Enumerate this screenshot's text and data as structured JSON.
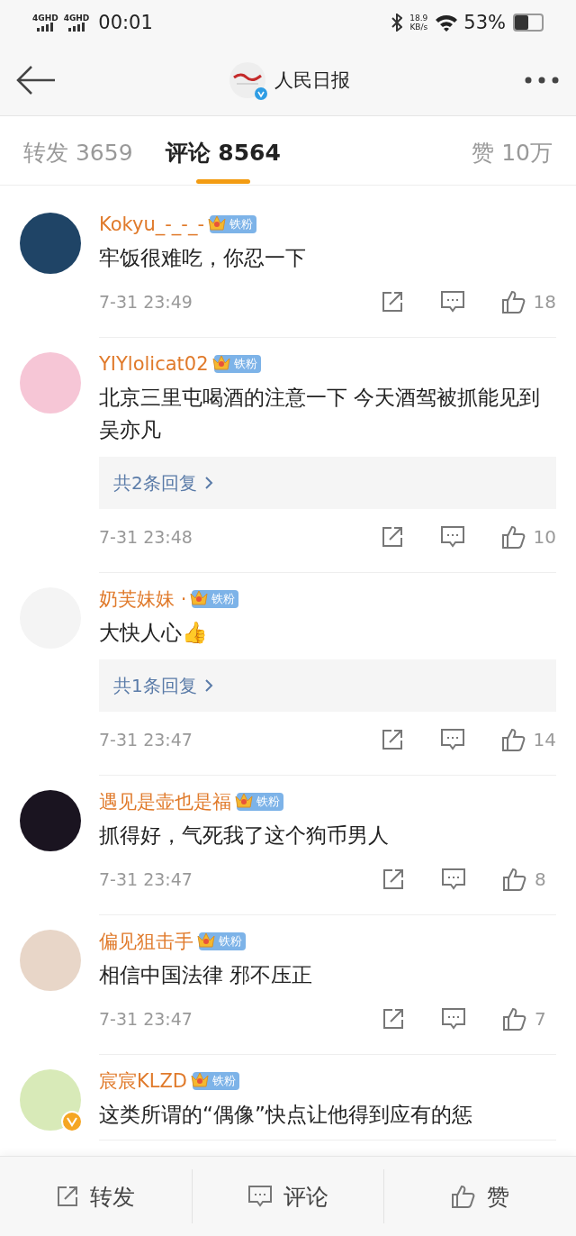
{
  "status_bar": {
    "networks": [
      "4GHD",
      "4GHD"
    ],
    "time": "00:01",
    "speed": "18.9",
    "speed_unit": "KB/s",
    "battery": "53%"
  },
  "header": {
    "title": "人民日报"
  },
  "tabs": [
    {
      "label": "转发 3659",
      "selected": false
    },
    {
      "label": "评论 8564",
      "selected": true
    },
    {
      "label": "赞 10万",
      "selected": false
    }
  ],
  "comments": [
    {
      "user": "Kokyu_-_-_-",
      "badge": "铁粉",
      "text": "牢饭很难吃，你忍一下",
      "time": "7-31 23:49",
      "likes": "18",
      "verified": false
    },
    {
      "user": "YIYlolicat02",
      "badge": "铁粉",
      "text": "北京三里屯喝酒的注意一下 今天酒驾被抓能见到吴亦凡",
      "replies": "共2条回复",
      "time": "7-31 23:48",
      "likes": "10",
      "verified": false
    },
    {
      "user": "奶芙妹妹 ·",
      "badge": "铁粉",
      "text": "大快人心👍",
      "replies": "共1条回复",
      "time": "7-31 23:47",
      "likes": "14",
      "verified": false
    },
    {
      "user": "遇见是壶也是福",
      "badge": "铁粉",
      "text": "抓得好，气死我了这个狗币男人",
      "time": "7-31 23:47",
      "likes": "8",
      "verified": false
    },
    {
      "user": "偏见狙击手",
      "badge": "铁粉",
      "text": "相信中国法律 邪不压正",
      "time": "7-31 23:47",
      "likes": "7",
      "verified": false
    },
    {
      "user": "宸宸KLZD",
      "badge": "铁粉",
      "text": "这类所谓的“偶像”快点让他得到应有的惩",
      "verified": true
    }
  ],
  "bottom_bar": [
    "转发",
    "评论",
    "赞"
  ]
}
